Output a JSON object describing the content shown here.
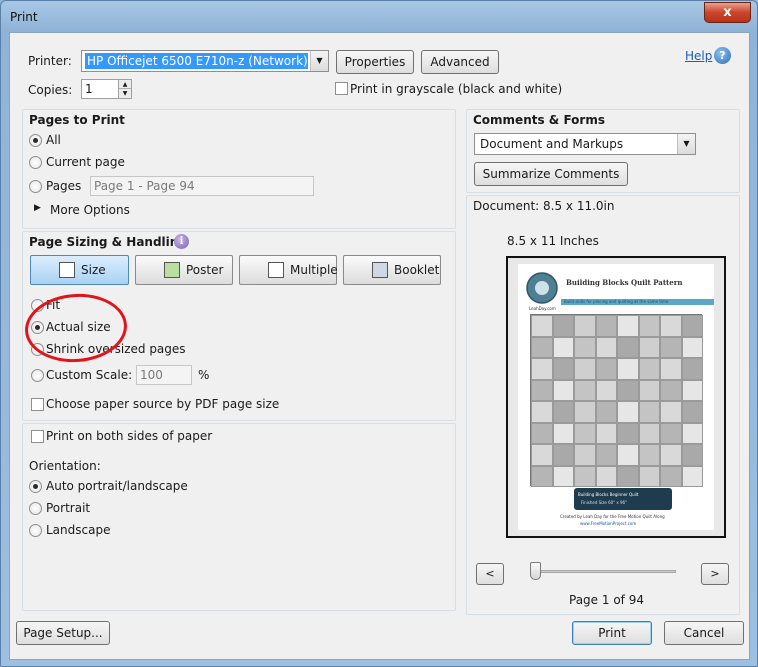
{
  "window": {
    "title": "Print",
    "close_label": "x"
  },
  "printer": {
    "label": "Printer:",
    "selected": "HP Officejet 6500 E710n-z (Network)",
    "properties_label": "Properties",
    "advanced_label": "Advanced"
  },
  "help": {
    "label": "Help",
    "icon_glyph": "?"
  },
  "copies": {
    "label": "Copies:",
    "value": "1"
  },
  "grayscale": {
    "label": "Print in grayscale (black and white)",
    "checked": false
  },
  "pages_to_print": {
    "title": "Pages to Print",
    "all_label": "All",
    "current_label": "Current page",
    "pages_label": "Pages",
    "pages_value": "Page 1 - Page 94",
    "more_options_label": "More Options",
    "selected": "all"
  },
  "page_sizing": {
    "title": "Page Sizing & Handling",
    "info_glyph": "i",
    "buttons": [
      {
        "label": "Size",
        "active": true,
        "icon": "size-icon"
      },
      {
        "label": "Poster",
        "active": false,
        "icon": "poster-icon"
      },
      {
        "label": "Multiple",
        "active": false,
        "icon": "multiple-icon"
      },
      {
        "label": "Booklet",
        "active": false,
        "icon": "booklet-icon"
      }
    ],
    "fit_label": "Fit",
    "actual_label": "Actual size",
    "shrink_label": "Shrink oversized pages",
    "custom_label": "Custom Scale:",
    "custom_value": "100",
    "percent_label": "%",
    "paper_source_label": "Choose paper source by PDF page size",
    "selected": "actual"
  },
  "both_sides": {
    "label": "Print on both sides of paper",
    "checked": false
  },
  "orientation": {
    "title": "Orientation:",
    "auto_label": "Auto portrait/landscape",
    "portrait_label": "Portrait",
    "landscape_label": "Landscape",
    "selected": "auto"
  },
  "comments_forms": {
    "title": "Comments & Forms",
    "selected": "Document and Markups",
    "summarize_label": "Summarize Comments"
  },
  "preview": {
    "document_label": "Document: 8.5 x 11.0in",
    "size_label": "8.5 x 11 Inches",
    "page_info": "Page 1 of 94",
    "prev_glyph": "<",
    "next_glyph": ">",
    "slider_position": 0.0,
    "thumbnail": {
      "title": "Building Blocks Quilt Pattern",
      "subtitle": "Build skills for piecing and quilting at the same time",
      "logo_caption": "LeahDay.com",
      "banner_line1": "Building Blocks Beginner Quilt",
      "banner_line2": "Finished Size 60\" x 96\"",
      "credit": "Created by Leah Day for the Free Motion Quilt Along",
      "url": "www.FreeMotionProject.com"
    }
  },
  "footer": {
    "page_setup_label": "Page Setup...",
    "print_label": "Print",
    "cancel_label": "Cancel"
  },
  "colors": {
    "annotation_circle": "#e2141a",
    "selection": "#3399ff",
    "help_link": "#1a5fb4"
  }
}
